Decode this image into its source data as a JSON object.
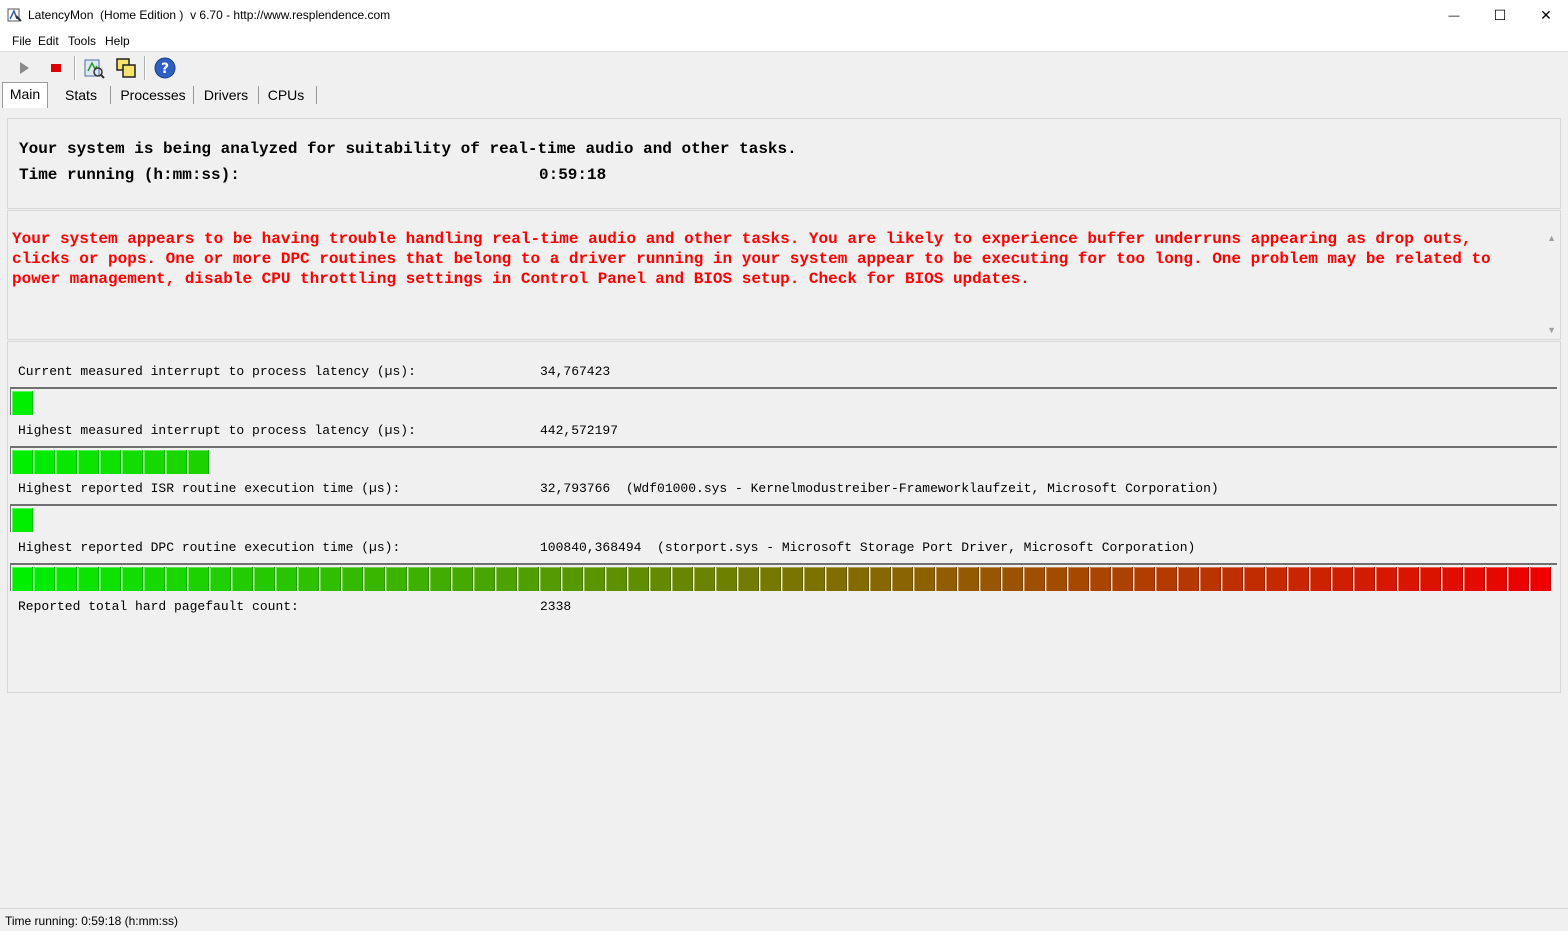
{
  "window": {
    "title": "LatencyMon  (Home Edition )  v 6.70 - http://www.resplendence.com",
    "minimize_glyph": "—",
    "maximize_glyph": "☐",
    "close_glyph": "✕"
  },
  "menu": {
    "file": "File",
    "edit": "Edit",
    "tools": "Tools",
    "help": "Help"
  },
  "toolbar": {
    "icons": [
      "play-icon",
      "stop-icon",
      "report-icon",
      "copy-windows-icon",
      "help-icon"
    ]
  },
  "tabs": [
    "Main",
    "Stats",
    "Processes",
    "Drivers",
    "CPUs"
  ],
  "summary": {
    "line1": "Your system is being analyzed for suitability of real-time audio and other tasks.",
    "time_label": "Time running (h:mm:ss):",
    "time_value": "0:59:18"
  },
  "warning": "Your system appears to be having trouble handling real-time audio and other tasks. You are likely to experience buffer underruns appearing as drop outs, clicks or pops. One or more DPC routines that belong to a driver running in your system appear to be executing for too long. One problem may be related to power management, disable CPU throttling settings in Control Panel and BIOS setup. Check for BIOS updates.",
  "metrics": [
    {
      "label": "Current measured interrupt to process latency (µs):",
      "value": "34,767423",
      "bar_segments": 1
    },
    {
      "label": "Highest measured interrupt to process latency (µs):",
      "value": "442,572197",
      "bar_segments": 9
    },
    {
      "label": "Highest reported ISR routine execution time (µs):",
      "value": "32,793766  (Wdf01000.sys - Kernelmodustreiber-Frameworklaufzeit, Microsoft Corporation)",
      "bar_segments": 1
    },
    {
      "label": "Highest reported DPC routine execution time (µs):",
      "value": "100840,368494  (storport.sys - Microsoft Storage Port Driver, Microsoft Corporation)",
      "bar_segments": 70
    }
  ],
  "pagefault": {
    "label": "Reported total hard pagefault count:",
    "value": "2338"
  },
  "status": "Time running: 0:59:18  (h:mm:ss)",
  "colors": {
    "warning": "#ff0000",
    "bar_start": "#00ee00",
    "bar_end": "#ee0000"
  }
}
